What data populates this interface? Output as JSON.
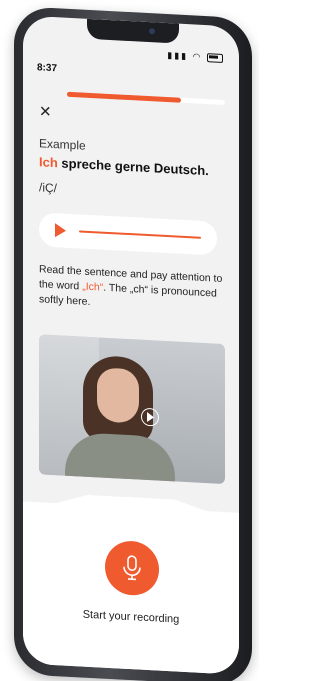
{
  "status_bar": {
    "time": "8:37"
  },
  "lesson": {
    "progress": 0.72,
    "section_label": "Example",
    "sentence_highlight": "Ich",
    "sentence_rest": " spreche gerne Deutsch.",
    "phonetic": "/iÇ/",
    "instruction_part1": "Read the sentence and pay attention to the word ",
    "instruction_highlight": "„Ich“",
    "instruction_part2": ". The „ch“ is pronounced softly here."
  },
  "recording": {
    "label": "Start your recording"
  },
  "icons": {
    "close": "close-icon",
    "play": "play-icon",
    "video_play": "video-play-icon",
    "microphone": "microphone-icon"
  },
  "colors": {
    "accent": "#ef5a2f",
    "screen_bg": "#f2f2f2"
  }
}
